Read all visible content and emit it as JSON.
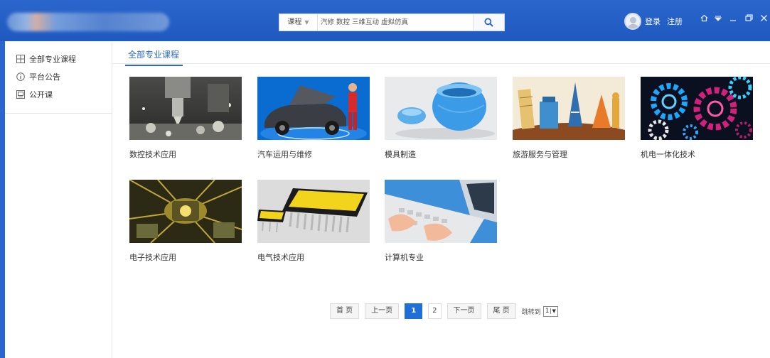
{
  "header": {
    "search": {
      "category": "课程",
      "placeholder": "汽修 数控 三维互动 虚拟仿真"
    },
    "login": "登录",
    "register": "注册"
  },
  "sidebar": {
    "items": [
      {
        "label": "全部专业课程",
        "icon": "grid-icon"
      },
      {
        "label": "平台公告",
        "icon": "info-icon"
      },
      {
        "label": "公开课",
        "icon": "video-icon"
      }
    ]
  },
  "main": {
    "tab": "全部专业课程",
    "courses": [
      {
        "title": "数控技术应用"
      },
      {
        "title": "汽车运用与维修"
      },
      {
        "title": "模具制造"
      },
      {
        "title": "旅游服务与管理"
      },
      {
        "title": "机电一体化技术"
      },
      {
        "title": "电子技术应用"
      },
      {
        "title": "电气技术应用"
      },
      {
        "title": "计算机专业"
      }
    ]
  },
  "pagination": {
    "first": "首 页",
    "prev": "上一页",
    "pages": [
      "1",
      "2"
    ],
    "current": "1",
    "next": "下一页",
    "last": "尾 页",
    "jump_label": "跳转到",
    "jump_value": "1"
  },
  "colors": {
    "brand": "#2a66cc",
    "active_page": "#1e6fd9"
  }
}
